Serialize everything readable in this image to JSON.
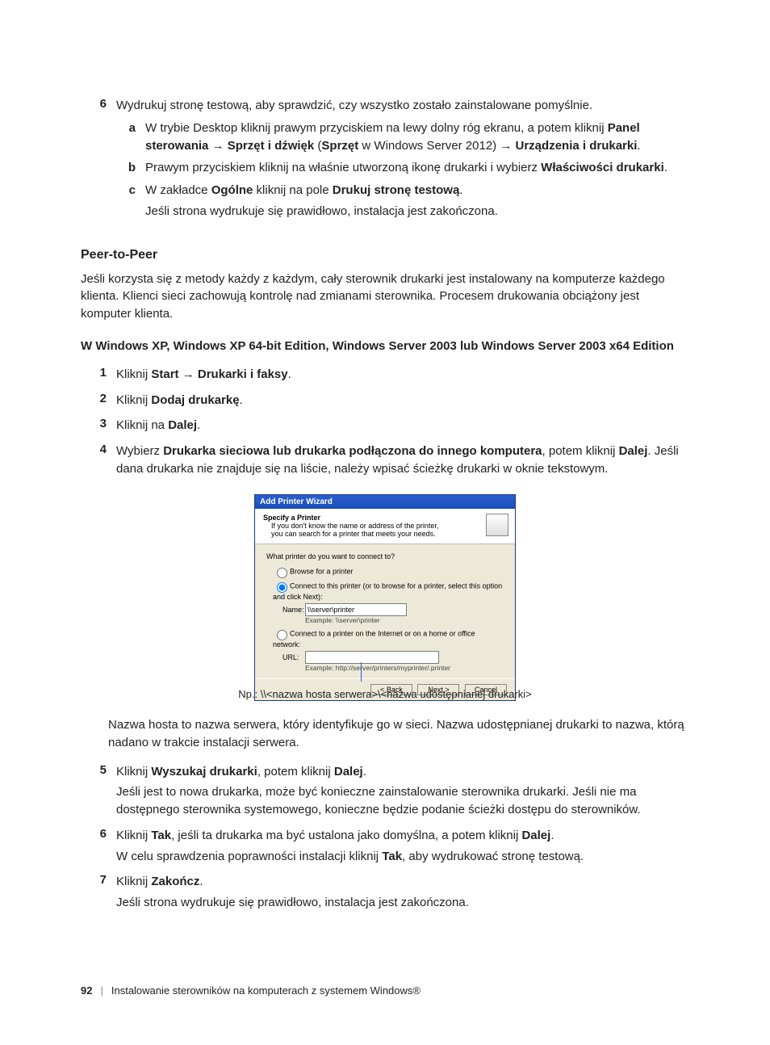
{
  "step6": {
    "num": "6",
    "text_pre": "Wydrukuj stronę testową, aby sprawdzić, czy wszystko zostało zainstalowane pomyślnie.",
    "a": {
      "letter": "a",
      "t1": "W trybie Desktop kliknij prawym przyciskiem na lewy dolny róg ekranu, a potem kliknij ",
      "b1": "Panel sterowania",
      "arrow1": " → ",
      "b2": "Sprzęt i dźwięk",
      "paren_open": " (",
      "b3": "Sprzęt",
      "mid": " w Windows Server 2012) ",
      "arrow2": "→ ",
      "b4": "Urządzenia i drukarki",
      "dot": "."
    },
    "b": {
      "letter": "b",
      "t1": "Prawym przyciskiem kliknij na właśnie utworzoną ikonę drukarki i wybierz ",
      "b1": "Właściwości drukarki",
      "dot": "."
    },
    "c": {
      "letter": "c",
      "t1": "W zakładce ",
      "b1": "Ogólne",
      "t2": " kliknij na pole ",
      "b2": "Drukuj stronę testową",
      "dot": ".",
      "line2": "Jeśli strona wydrukuje się prawidłowo, instalacja jest zakończona."
    }
  },
  "p2p": {
    "heading": "Peer-to-Peer",
    "para": "Jeśli korzysta się z metody każdy z każdym, cały sterownik drukarki jest instalowany na komputerze każdego klienta. Klienci sieci zachowują kontrolę nad zmianami sterownika. Procesem drukowania obciążony jest komputer klienta.",
    "subhead": "W Windows XP, Windows XP 64-bit Edition, Windows Server 2003 lub Windows Server 2003 x64 Edition"
  },
  "steps": {
    "s1": {
      "num": "1",
      "t1": "Kliknij ",
      "b1": "Start",
      "arrow": " → ",
      "b2": "Drukarki i faksy",
      "dot": "."
    },
    "s2": {
      "num": "2",
      "t1": "Kliknij ",
      "b1": "Dodaj drukarkę",
      "dot": "."
    },
    "s3": {
      "num": "3",
      "t1": "Kliknij na ",
      "b1": "Dalej",
      "dot": "."
    },
    "s4": {
      "num": "4",
      "t1": "Wybierz ",
      "b1": "Drukarka sieciowa lub drukarka podłączona do innego komputera",
      "t2": ", potem kliknij ",
      "b2": "Dalej",
      "t3": ". Jeśli dana drukarka nie znajduje się na liście, należy wpisać ścieżkę drukarki w oknie tekstowym."
    },
    "s5": {
      "num": "5",
      "t1": "Kliknij ",
      "b1": "Wyszukaj drukarki",
      "t2": ", potem kliknij ",
      "b2": "Dalej",
      "dot": ".",
      "line2": "Jeśli jest to nowa drukarka, może być konieczne zainstalowanie sterownika drukarki. Jeśli nie ma dostępnego sterownika systemowego, konieczne będzie podanie ścieżki dostępu do sterowników."
    },
    "s6": {
      "num": "6",
      "t1": "Kliknij ",
      "b1": "Tak",
      "t2": ", jeśli ta drukarka ma być ustalona jako domyślna, a potem kliknij ",
      "b2": "Dalej",
      "dot": ".",
      "line2_a": "W celu sprawdzenia poprawności instalacji kliknij ",
      "line2_b": "Tak",
      "line2_c": ", aby wydrukować stronę testową."
    },
    "s7": {
      "num": "7",
      "t1": "Kliknij ",
      "b1": "Zakończ",
      "dot": ".",
      "line2": "Jeśli strona wydrukuje się prawidłowo, instalacja jest zakończona."
    }
  },
  "dialog": {
    "title": "Add Printer Wizard",
    "spec_title": "Specify a Printer",
    "spec_sub": "If you don't know the name or address of the printer, you can search for a printer that meets your needs.",
    "question": "What printer do you want to connect to?",
    "opt1": "Browse for a printer",
    "opt2": "Connect to this printer (or to browse for a printer, select this option and click Next):",
    "name_label": "Name:",
    "name_value": "\\\\server\\printer",
    "name_example": "Example: \\\\server\\printer",
    "opt3": "Connect to a printer on the Internet or on a home or office network:",
    "url_label": "URL:",
    "url_example": "Example: http://server/printers/myprinter/.printer",
    "back": "< Back",
    "next": "Next >",
    "cancel": "Cancel"
  },
  "caption": "Np.: \\\\<nazwa hosta serwera>\\<nazwa udostępnianej drukarki>",
  "after_dialog": "Nazwa hosta to nazwa serwera, który identyfikuje go w sieci. Nazwa udostępnianej drukarki to nazwa, którą nadano w trakcie instalacji serwera.",
  "footer": {
    "page": "92",
    "chapter": "Instalowanie sterowników na komputerach z systemem Windows®"
  }
}
